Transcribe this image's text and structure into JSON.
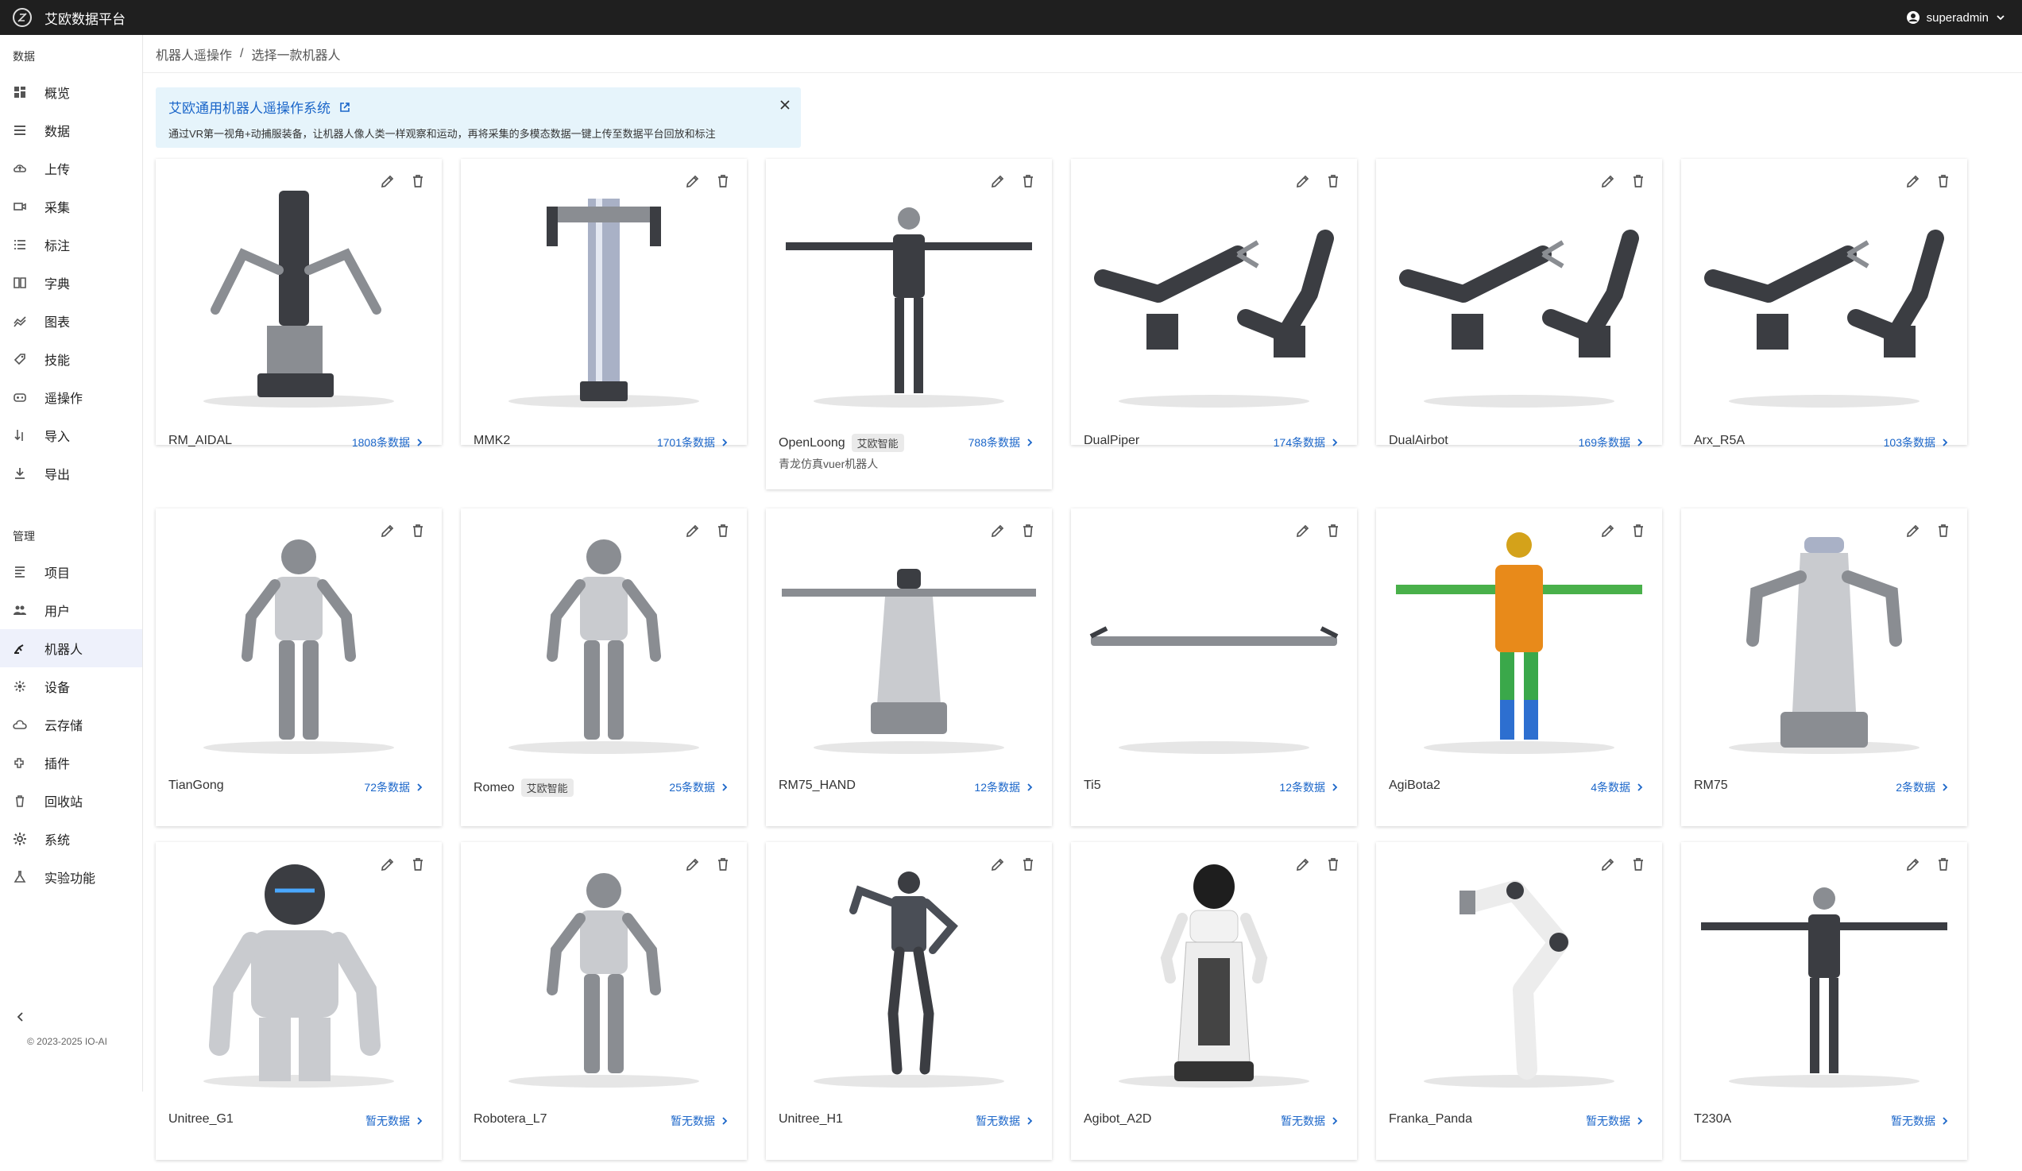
{
  "app": {
    "title": "艾欧数据平台",
    "user": "superadmin"
  },
  "sidebar": {
    "groups": [
      {
        "label": "数据",
        "items": [
          "概览",
          "数据",
          "上传",
          "采集",
          "标注",
          "字典",
          "图表",
          "技能",
          "遥操作",
          "导入",
          "导出"
        ]
      },
      {
        "label": "管理",
        "items": [
          "项目",
          "用户",
          "机器人",
          "设备",
          "云存储",
          "插件",
          "回收站",
          "系统",
          "实验功能"
        ]
      }
    ],
    "active": "机器人",
    "copyright": "© 2023-2025 IO-AI"
  },
  "breadcrumb": [
    "机器人遥操作",
    "选择一款机器人"
  ],
  "notice": {
    "title": "艾欧通用机器人遥操作系统",
    "description": "通过VR第一视角+动捕服装备，让机器人像人类一样观察和运动，再将采集的多模态数据一键上传至数据平台回放和标注"
  },
  "robots": [
    {
      "name": "RM_AIDAL",
      "count": "1808条数据",
      "tag": "",
      "desc": "",
      "kind": "tower"
    },
    {
      "name": "MMK2",
      "count": "1701条数据",
      "tag": "",
      "desc": "",
      "kind": "pillar"
    },
    {
      "name": "OpenLoong",
      "count": "788条数据",
      "tag": "艾欧智能",
      "desc": "青龙仿真vuer机器人",
      "kind": "humanoid-t"
    },
    {
      "name": "DualPiper",
      "count": "174条数据",
      "tag": "",
      "desc": "",
      "kind": "dual-arm"
    },
    {
      "name": "DualAirbot",
      "count": "169条数据",
      "tag": "",
      "desc": "",
      "kind": "dual-arm"
    },
    {
      "name": "Arx_R5A",
      "count": "103条数据",
      "tag": "",
      "desc": "",
      "kind": "dual-arm"
    },
    {
      "name": "TianGong",
      "count": "72条数据",
      "tag": "",
      "desc": "",
      "kind": "humanoid"
    },
    {
      "name": "Romeo",
      "count": "25条数据",
      "tag": "艾欧智能",
      "desc": "",
      "kind": "humanoid"
    },
    {
      "name": "RM75_HAND",
      "count": "12条数据",
      "tag": "",
      "desc": "",
      "kind": "pillar-t"
    },
    {
      "name": "Ti5",
      "count": "12条数据",
      "tag": "",
      "desc": "",
      "kind": "flat"
    },
    {
      "name": "AgiBota2",
      "count": "4条数据",
      "tag": "",
      "desc": "",
      "kind": "humanoid-color"
    },
    {
      "name": "RM75",
      "count": "2条数据",
      "tag": "",
      "desc": "",
      "kind": "pillar-arms"
    },
    {
      "name": "Unitree_G1",
      "count": "暂无数据",
      "tag": "",
      "desc": "",
      "kind": "humanoid-big"
    },
    {
      "name": "Robotera_L7",
      "count": "暂无数据",
      "tag": "",
      "desc": "",
      "kind": "humanoid"
    },
    {
      "name": "Unitree_H1",
      "count": "暂无数据",
      "tag": "",
      "desc": "",
      "kind": "humanoid-dark"
    },
    {
      "name": "Agibot_A2D",
      "count": "暂无数据",
      "tag": "",
      "desc": "",
      "kind": "service"
    },
    {
      "name": "Franka_Panda",
      "count": "暂无数据",
      "tag": "",
      "desc": "",
      "kind": "single-arm"
    },
    {
      "name": "T230A",
      "count": "暂无数据",
      "tag": "",
      "desc": "",
      "kind": "humanoid-t"
    }
  ]
}
